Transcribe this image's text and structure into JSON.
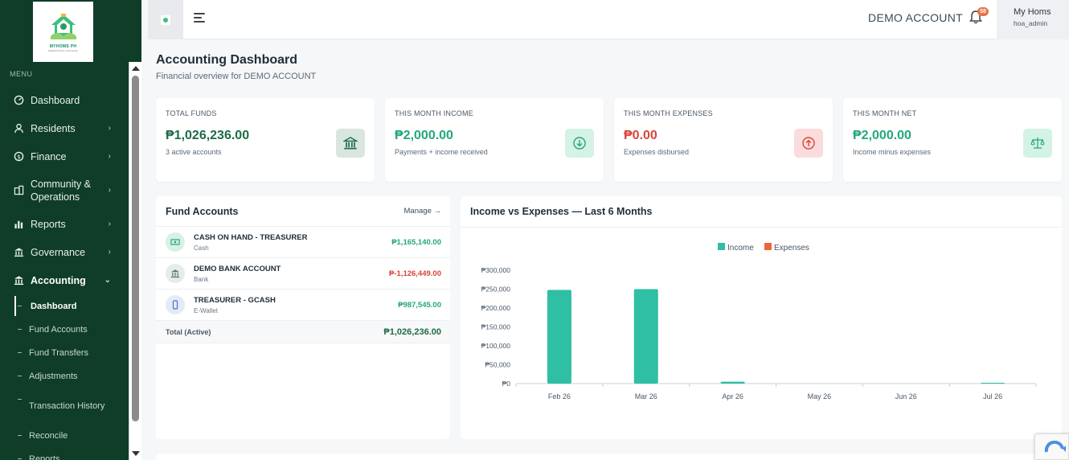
{
  "sidebar": {
    "logo_brand": "MYHOMS PH",
    "logo_tag": "Digital Property Community",
    "menu_label": "MENU",
    "items": [
      {
        "label": "Dashboard",
        "has_chevron": false
      },
      {
        "label": "Residents",
        "has_chevron": true
      },
      {
        "label": "Finance",
        "has_chevron": true
      },
      {
        "label": "Community & Operations",
        "has_chevron": true
      },
      {
        "label": "Reports",
        "has_chevron": true
      },
      {
        "label": "Governance",
        "has_chevron": true
      },
      {
        "label": "Accounting",
        "expanded": true
      }
    ],
    "accounting_sub": [
      "Dashboard",
      "Fund Accounts",
      "Fund Transfers",
      "Adjustments",
      "Transaction History",
      "Reconcile",
      "Reports"
    ],
    "active_sub": "Dashboard"
  },
  "topbar": {
    "account_name": "DEMO ACCOUNT",
    "notification_count": "58",
    "user_name": "My Homs",
    "user_role": "hoa_admin"
  },
  "page": {
    "title": "Accounting Dashboard",
    "subtitle": "Financial overview for DEMO ACCOUNT"
  },
  "stats": [
    {
      "label": "TOTAL FUNDS",
      "value": "₱1,026,236.00",
      "sub": "3 active accounts",
      "color": "#1d6b45",
      "icon": "bank-icon"
    },
    {
      "label": "THIS MONTH INCOME",
      "value": "₱2,000.00",
      "sub": "Payments + income received",
      "color": "#23a877",
      "icon": "arrow-down-circle-icon"
    },
    {
      "label": "THIS MONTH EXPENSES",
      "value": "₱0.00",
      "sub": "Expenses disbursed",
      "color": "#d9443a",
      "icon": "arrow-up-circle-icon"
    },
    {
      "label": "THIS MONTH NET",
      "value": "₱2,000.00",
      "sub": "Income minus expenses",
      "color": "#23a877",
      "icon": "scale-icon"
    }
  ],
  "fund_accounts": {
    "title": "Fund Accounts",
    "manage_label": "Manage →",
    "rows": [
      {
        "name": "CASH ON HAND - TREASURER",
        "type": "Cash",
        "amount": "₱1,165,140.00",
        "amount_color": "#23a877",
        "icon": "cash-icon"
      },
      {
        "name": "DEMO BANK ACCOUNT",
        "type": "Bank",
        "amount": "₱-1,126,449.00",
        "amount_color": "#d9443a",
        "icon": "bank-icon"
      },
      {
        "name": "TREASURER - GCASH",
        "type": "E-Wallet",
        "amount": "₱987,545.00",
        "amount_color": "#23a877",
        "icon": "phone-icon"
      }
    ],
    "total_label": "Total (Active)",
    "total_value": "₱1,026,236.00"
  },
  "chart_data": {
    "type": "bar",
    "title": "Income vs Expenses — Last 6 Months",
    "categories": [
      "Feb 26",
      "Mar 26",
      "Apr 26",
      "May 26",
      "Jun 26",
      "Jul 26"
    ],
    "series": [
      {
        "name": "Income",
        "color": "#2ebfa5",
        "values": [
          248000,
          250000,
          5000,
          0,
          0,
          2000
        ]
      },
      {
        "name": "Expenses",
        "color": "#f0643c",
        "values": [
          0,
          0,
          0,
          0,
          0,
          0
        ]
      }
    ],
    "ylim": [
      0,
      300000
    ],
    "yticks": [
      "₱300,000",
      "₱250,000",
      "₱200,000",
      "₱150,000",
      "₱100,000",
      "₱50,000",
      "₱0"
    ],
    "legend": "top-center"
  }
}
